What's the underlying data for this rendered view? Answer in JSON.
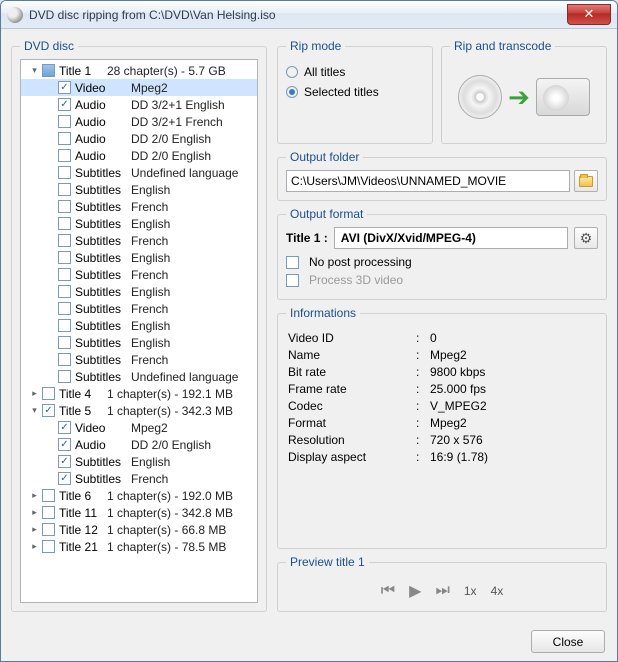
{
  "window": {
    "title": "DVD disc ripping from C:\\DVD\\Van Helsing.iso"
  },
  "tree": {
    "header": "DVD disc",
    "items": [
      {
        "lvl": 1,
        "exp": "▾",
        "cb": "partial",
        "label": "Title 1",
        "desc": "28 chapter(s) - 5.7 GB",
        "w": 48
      },
      {
        "lvl": 2,
        "exp": "",
        "cb": "checked",
        "label": "Video",
        "desc": "Mpeg2",
        "w": 56,
        "sel": true
      },
      {
        "lvl": 2,
        "exp": "",
        "cb": "checked",
        "label": "Audio",
        "desc": "DD 3/2+1 English",
        "w": 56
      },
      {
        "lvl": 2,
        "exp": "",
        "cb": "",
        "label": "Audio",
        "desc": "DD 3/2+1 French",
        "w": 56
      },
      {
        "lvl": 2,
        "exp": "",
        "cb": "",
        "label": "Audio",
        "desc": "DD 2/0 English",
        "w": 56
      },
      {
        "lvl": 2,
        "exp": "",
        "cb": "",
        "label": "Audio",
        "desc": "DD 2/0 English",
        "w": 56
      },
      {
        "lvl": 2,
        "exp": "",
        "cb": "",
        "label": "Subtitles",
        "desc": "Undefined language",
        "w": 56
      },
      {
        "lvl": 2,
        "exp": "",
        "cb": "",
        "label": "Subtitles",
        "desc": "English",
        "w": 56
      },
      {
        "lvl": 2,
        "exp": "",
        "cb": "",
        "label": "Subtitles",
        "desc": "French",
        "w": 56
      },
      {
        "lvl": 2,
        "exp": "",
        "cb": "",
        "label": "Subtitles",
        "desc": "English",
        "w": 56
      },
      {
        "lvl": 2,
        "exp": "",
        "cb": "",
        "label": "Subtitles",
        "desc": "French",
        "w": 56
      },
      {
        "lvl": 2,
        "exp": "",
        "cb": "",
        "label": "Subtitles",
        "desc": "English",
        "w": 56
      },
      {
        "lvl": 2,
        "exp": "",
        "cb": "",
        "label": "Subtitles",
        "desc": "French",
        "w": 56
      },
      {
        "lvl": 2,
        "exp": "",
        "cb": "",
        "label": "Subtitles",
        "desc": "English",
        "w": 56
      },
      {
        "lvl": 2,
        "exp": "",
        "cb": "",
        "label": "Subtitles",
        "desc": "French",
        "w": 56
      },
      {
        "lvl": 2,
        "exp": "",
        "cb": "",
        "label": "Subtitles",
        "desc": "English",
        "w": 56
      },
      {
        "lvl": 2,
        "exp": "",
        "cb": "",
        "label": "Subtitles",
        "desc": "English",
        "w": 56
      },
      {
        "lvl": 2,
        "exp": "",
        "cb": "",
        "label": "Subtitles",
        "desc": "French",
        "w": 56
      },
      {
        "lvl": 2,
        "exp": "",
        "cb": "",
        "label": "Subtitles",
        "desc": "Undefined language",
        "w": 56
      },
      {
        "lvl": 1,
        "exp": "▸",
        "cb": "",
        "label": "Title 4",
        "desc": "1 chapter(s) - 192.1 MB",
        "w": 48
      },
      {
        "lvl": 1,
        "exp": "▾",
        "cb": "checked",
        "label": "Title 5",
        "desc": "1 chapter(s) - 342.3 MB",
        "w": 48
      },
      {
        "lvl": 2,
        "exp": "",
        "cb": "checked",
        "label": "Video",
        "desc": "Mpeg2",
        "w": 56
      },
      {
        "lvl": 2,
        "exp": "",
        "cb": "checked",
        "label": "Audio",
        "desc": "DD 2/0 English",
        "w": 56
      },
      {
        "lvl": 2,
        "exp": "",
        "cb": "checked",
        "label": "Subtitles",
        "desc": "English",
        "w": 56
      },
      {
        "lvl": 2,
        "exp": "",
        "cb": "checked",
        "label": "Subtitles",
        "desc": "French",
        "w": 56
      },
      {
        "lvl": 1,
        "exp": "▸",
        "cb": "",
        "label": "Title 6",
        "desc": "1 chapter(s) - 192.0 MB",
        "w": 48
      },
      {
        "lvl": 1,
        "exp": "▸",
        "cb": "",
        "label": "Title 11",
        "desc": "1 chapter(s) - 342.8 MB",
        "w": 48
      },
      {
        "lvl": 1,
        "exp": "▸",
        "cb": "",
        "label": "Title 12",
        "desc": "1 chapter(s) - 66.8 MB",
        "w": 48
      },
      {
        "lvl": 1,
        "exp": "▸",
        "cb": "",
        "label": "Title 21",
        "desc": "1 chapter(s) - 78.5 MB",
        "w": 48
      }
    ]
  },
  "ripmode": {
    "legend": "Rip mode",
    "all": "All titles",
    "selected": "Selected titles",
    "choice": "selected"
  },
  "transcode_legend": "Rip and transcode",
  "output_folder": {
    "legend": "Output folder",
    "path": "C:\\Users\\JM\\Videos\\UNNAMED_MOVIE"
  },
  "output_format": {
    "legend": "Output format",
    "title_label": "Title 1 :",
    "format": "AVI (DivX/Xvid/MPEG-4)",
    "no_post": "No post processing",
    "proc3d": "Process 3D video"
  },
  "info": {
    "legend": "Informations",
    "rows": [
      {
        "k": "Video ID",
        "v": "0"
      },
      {
        "k": "Name",
        "v": "Mpeg2"
      },
      {
        "k": "Bit rate",
        "v": "9800 kbps"
      },
      {
        "k": "Frame rate",
        "v": "25.000 fps"
      },
      {
        "k": "Codec",
        "v": "V_MPEG2"
      },
      {
        "k": "Format",
        "v": "Mpeg2"
      },
      {
        "k": "Resolution",
        "v": "720 x 576"
      },
      {
        "k": "Display aspect",
        "v": "16:9 (1.78)"
      }
    ]
  },
  "preview": {
    "legend": "Preview title 1",
    "s1": "1x",
    "s4": "4x"
  },
  "footer": {
    "close": "Close"
  }
}
